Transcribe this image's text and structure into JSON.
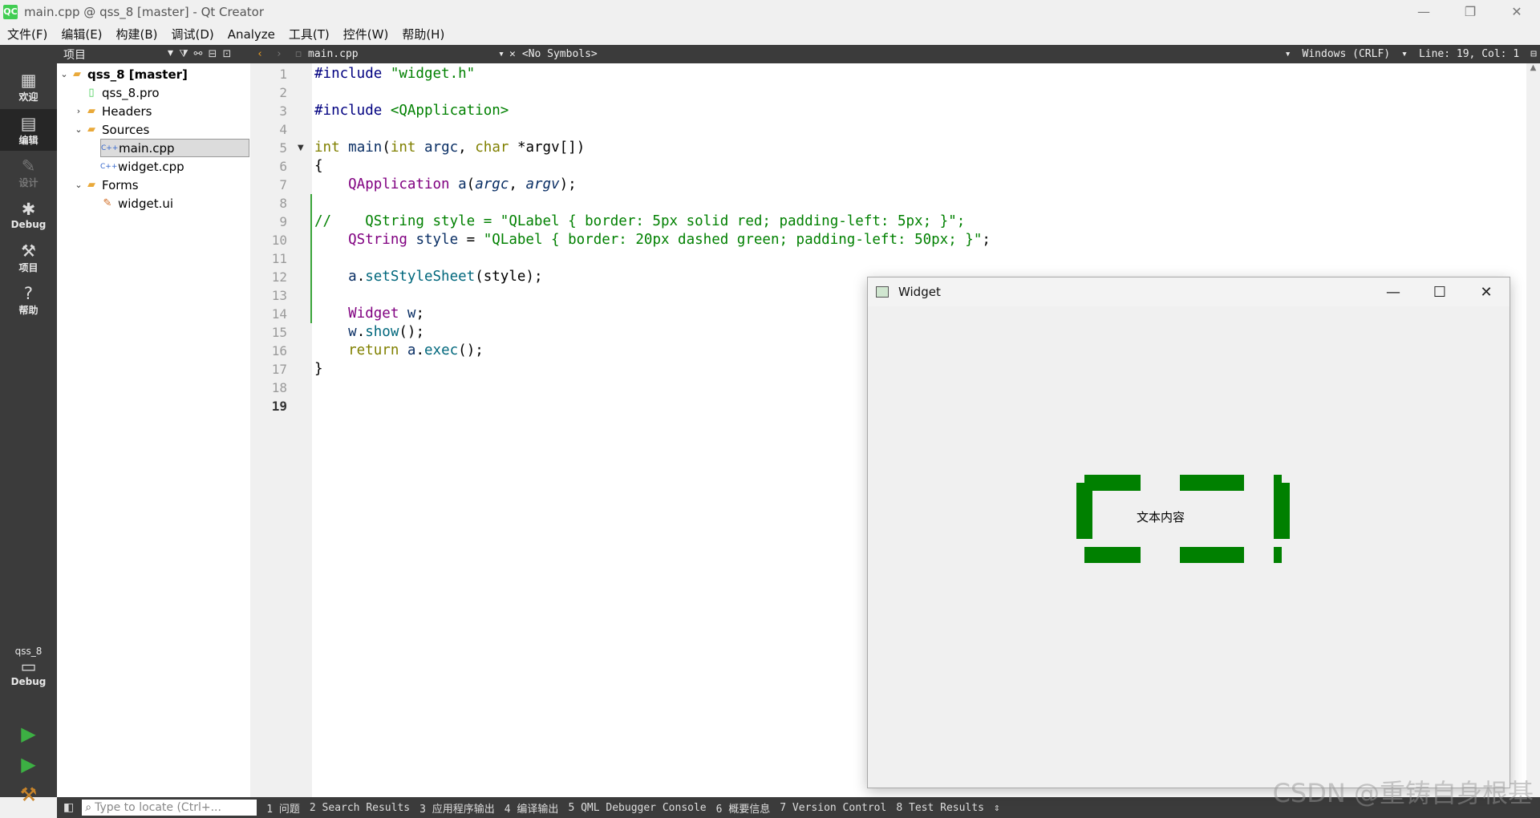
{
  "window": {
    "title": "main.cpp @ qss_8 [master] - Qt Creator",
    "logo": "QC",
    "minimize": "—",
    "restore": "❐",
    "close": "✕"
  },
  "menu": [
    "文件(F)",
    "编辑(E)",
    "构建(B)",
    "调试(D)",
    "Analyze",
    "工具(T)",
    "控件(W)",
    "帮助(H)"
  ],
  "modes": {
    "welcome": "欢迎",
    "edit": "编辑",
    "design": "设计",
    "debug": "Debug",
    "project": "项目",
    "help": "帮助",
    "kit_project": "qss_8",
    "kit_mode": "Debug"
  },
  "project_panel": {
    "selector": "项目",
    "tree": [
      {
        "label": "qss_8 [master]",
        "bold": true
      },
      {
        "label": "qss_8.pro"
      },
      {
        "label": "Headers"
      },
      {
        "label": "Sources"
      },
      {
        "label": "main.cpp",
        "selected": true
      },
      {
        "label": "widget.cpp"
      },
      {
        "label": "Forms"
      },
      {
        "label": "widget.ui"
      }
    ]
  },
  "editor": {
    "file": "main.cpp",
    "symbols": "<No Symbols>",
    "encoding": "Windows (CRLF)",
    "position": "Line: 19, Col: 1",
    "line_numbers": [
      "1",
      "2",
      "3",
      "4",
      "5",
      "6",
      "7",
      "8",
      "9",
      "10",
      "11",
      "12",
      "13",
      "14",
      "15",
      "16",
      "17",
      "18",
      "19"
    ],
    "code": {
      "l1_pp": "#include ",
      "l1_str": "\"widget.h\"",
      "l3_pp": "#include ",
      "l3_str": "<QApplication>",
      "l5_int": "int ",
      "l5_main": "main",
      "l5_open": "(",
      "l5_int2": "int ",
      "l5_argc": "argc",
      "l5_comma": ", ",
      "l5_char": "char ",
      "l5_argv": "*argv[])",
      "l6": "{",
      "l7_type": "    QApplication ",
      "l7_a": "a",
      "l7_open": "(",
      "l7_argc": "argc",
      "l7_comma": ", ",
      "l7_argv": "argv",
      "l7_close": ");",
      "l9": "//    QString style = \"QLabel { border: 5px solid red; padding-left: 5px; }\";",
      "l10_type": "    QString ",
      "l10_var": "style",
      "l10_eq": " = ",
      "l10_str": "\"QLabel { border: 20px dashed green; padding-left: 50px; }\"",
      "l10_end": ";",
      "l12_a": "    a",
      "l12_dot": ".",
      "l12_fn": "setStyleSheet",
      "l12_rest": "(style);",
      "l15_type": "    Widget ",
      "l15_var": "w",
      "l15_end": ";",
      "l16_w": "    w",
      "l16_dot": ".",
      "l16_fn": "show",
      "l16_end": "();",
      "l17_ret": "    return ",
      "l17_a": "a",
      "l17_dot": ".",
      "l17_fn": "exec",
      "l17_end": "();",
      "l18": "}"
    }
  },
  "status": {
    "locator_placeholder": "Type to locate (Ctrl+...",
    "panes": [
      "1 问题",
      "2 Search Results",
      "3 应用程序输出",
      "4 编译输出",
      "5 QML Debugger Console",
      "6 概要信息",
      "7 Version Control",
      "8 Test Results"
    ]
  },
  "widget_window": {
    "title": "Widget",
    "label_text": "文本内容",
    "border_color": "#008000"
  },
  "watermark": "CSDN @重铸自身根基"
}
